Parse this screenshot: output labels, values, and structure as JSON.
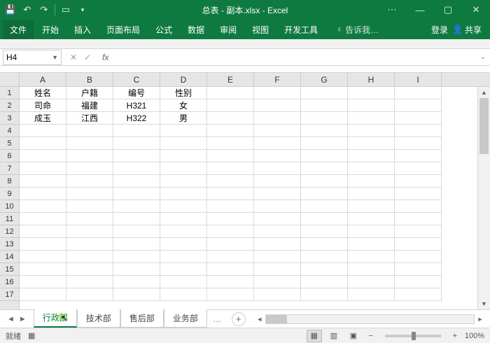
{
  "title": "总表 - 副本.xlsx - Excel",
  "ribbon": {
    "file": "文件",
    "tabs": [
      "开始",
      "插入",
      "页面布局",
      "公式",
      "数据",
      "审阅",
      "视图",
      "开发工具"
    ],
    "tell_icon": "♀",
    "tell": "告诉我…",
    "signin": "登录",
    "share": "共享"
  },
  "namebox": "H4",
  "fx": {
    "cancel": "✕",
    "enter": "✓",
    "fx": "fx"
  },
  "columns": [
    "A",
    "B",
    "C",
    "D",
    "E",
    "F",
    "G",
    "H",
    "I"
  ],
  "rows": [
    "1",
    "2",
    "3",
    "4",
    "5",
    "6",
    "7",
    "8",
    "9",
    "10",
    "11",
    "12",
    "13",
    "14",
    "15",
    "16",
    "17"
  ],
  "cells": {
    "A1": "姓名",
    "B1": "户籍",
    "C1": "编号",
    "D1": "性别",
    "A2": "司命",
    "B2": "福建",
    "C2": "H321",
    "D2": "女",
    "A3": "成玉",
    "B3": "江西",
    "C3": "H322",
    "D3": "男"
  },
  "sheets": {
    "active": "行政部",
    "tabs": [
      "行政部",
      "技术部",
      "售后部",
      "业务部"
    ],
    "more": "…",
    "add": "+"
  },
  "status": {
    "ready": "就绪",
    "zoom": "100%",
    "minus": "−",
    "plus": "+"
  }
}
